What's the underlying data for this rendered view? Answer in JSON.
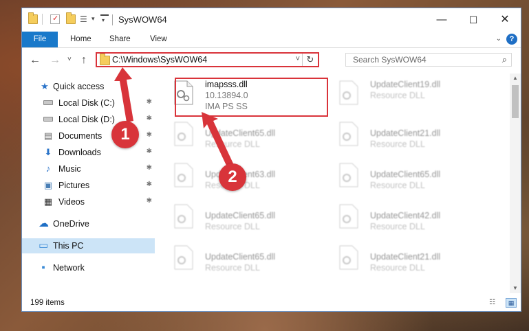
{
  "window": {
    "title": "SysWOW64",
    "controls": {
      "minimize": "—",
      "maximize": "☐",
      "close": "✕"
    }
  },
  "ribbon": {
    "tabs": [
      "File",
      "Home",
      "Share",
      "View"
    ],
    "expand_icon": "chevron-down-icon",
    "help_icon": "help-icon",
    "help_label": "?"
  },
  "nav": {
    "back_icon": "←",
    "forward_icon": "→",
    "recent_icon": "˅",
    "up_icon": "↑",
    "address": "C:\\Windows\\SysWOW64",
    "address_dropdown": "˅",
    "refresh_icon": "↻",
    "search_placeholder": "Search SysWOW64",
    "search_icon": "⌕"
  },
  "sidebar": {
    "items": [
      {
        "label": "Quick access",
        "icon": "★",
        "pinned": false
      },
      {
        "label": "Local Disk (C:)",
        "icon": "drive",
        "pinned": true
      },
      {
        "label": "Local Disk (D:)",
        "icon": "drive",
        "pinned": true
      },
      {
        "label": "Documents",
        "icon": "▤",
        "pinned": true
      },
      {
        "label": "Downloads",
        "icon": "⬇",
        "pinned": true
      },
      {
        "label": "Music",
        "icon": "♪",
        "pinned": true
      },
      {
        "label": "Pictures",
        "icon": "▣",
        "pinned": true
      },
      {
        "label": "Videos",
        "icon": "▦",
        "pinned": true
      },
      {
        "label": "OneDrive",
        "icon": "☁",
        "pinned": false
      },
      {
        "label": "This PC",
        "icon": "▭",
        "pinned": false,
        "selected": true
      },
      {
        "label": "Network",
        "icon": "▪",
        "pinned": false
      }
    ],
    "pin_icon": "✱"
  },
  "files": [
    {
      "name": "imapsss.dll",
      "line2": "10.13894.0",
      "line3": "IMA PS SS"
    },
    {
      "name": "UpdateClient19.dll",
      "line2": "Resource DLL"
    },
    {
      "name": "UpdateClient65.dll",
      "line2": "Resource DLL"
    },
    {
      "name": "UpdateClient21.dll",
      "line2": "Resource DLL"
    },
    {
      "name": "UpdateClient63.dll",
      "line2": "Resource DLL"
    },
    {
      "name": "UpdateClient65.dll",
      "line2": "Resource DLL"
    },
    {
      "name": "UpdateClient65.dll",
      "line2": "Resource DLL"
    },
    {
      "name": "UpdateClient42.dll",
      "line2": "Resource DLL"
    },
    {
      "name": "UpdateClient65.dll",
      "line2": "Resource DLL"
    },
    {
      "name": "UpdateClient21.dll",
      "line2": "Resource DLL"
    }
  ],
  "status": {
    "item_count": "199 items"
  },
  "callouts": {
    "step1": "1",
    "step2": "2"
  },
  "colors": {
    "accent": "#1979ca",
    "highlight_red": "#d9333a",
    "selected_bg": "#cce4f7"
  }
}
